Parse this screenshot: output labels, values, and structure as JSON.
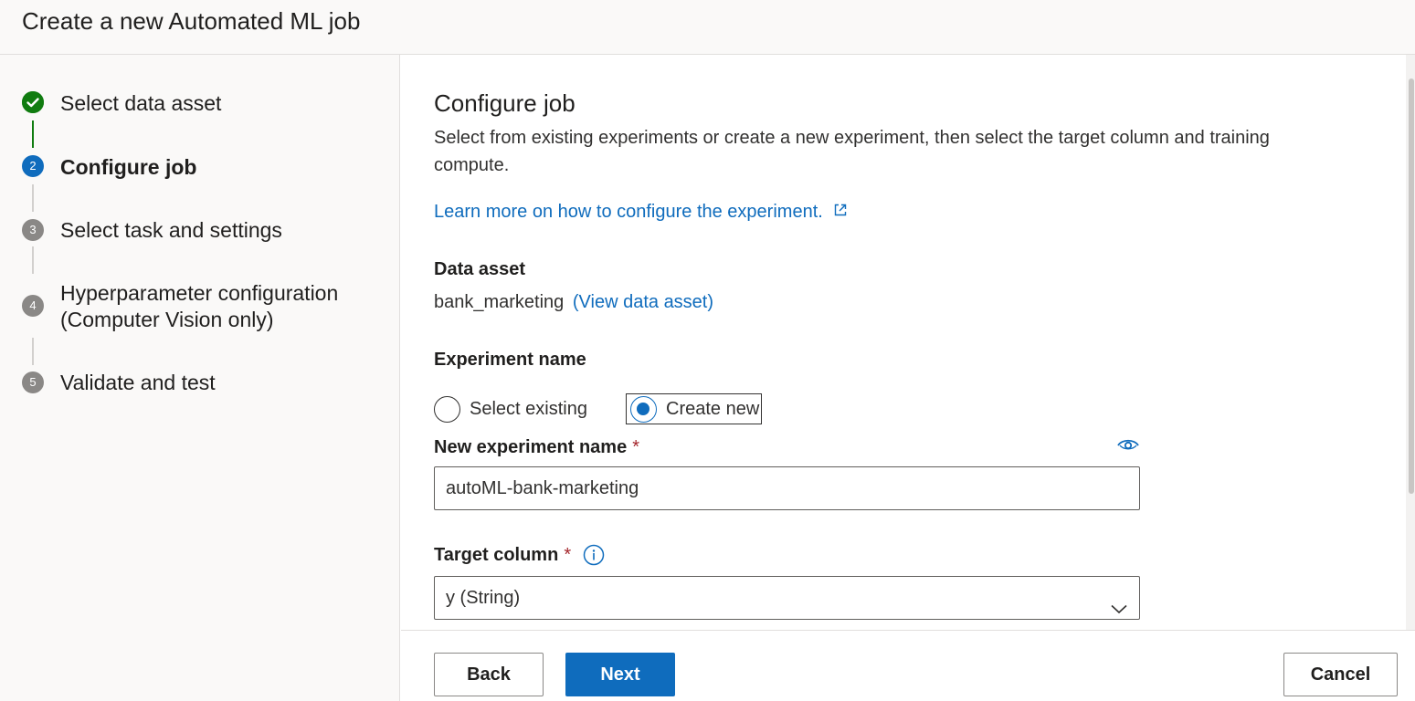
{
  "header": {
    "title": "Create a new Automated ML job"
  },
  "steps": [
    {
      "number": "",
      "label": "Select data asset",
      "status": "done"
    },
    {
      "number": "2",
      "label": "Configure job",
      "status": "active"
    },
    {
      "number": "3",
      "label": "Select task and settings",
      "status": "todo"
    },
    {
      "number": "4",
      "label_line1": "Hyperparameter configuration",
      "label_line2": "(Computer Vision only)",
      "status": "todo"
    },
    {
      "number": "5",
      "label": "Validate and test",
      "status": "todo"
    }
  ],
  "content": {
    "title": "Configure job",
    "description": "Select from existing experiments or create a new experiment, then select the target column and training compute.",
    "learn_more": "Learn more on how to configure the experiment.",
    "data_asset": {
      "label": "Data asset",
      "value": "bank_marketing",
      "link": "(View data asset)"
    },
    "experiment": {
      "label": "Experiment name",
      "option_existing": "Select existing",
      "option_new": "Create new",
      "selected": "Create new"
    },
    "new_experiment_name": {
      "label": "New experiment name",
      "required_mark": "*",
      "value": "autoML-bank-marketing"
    },
    "target_column": {
      "label": "Target column",
      "required_mark": "*",
      "value": "y (String)"
    }
  },
  "footer": {
    "back": "Back",
    "next": "Next",
    "cancel": "Cancel"
  },
  "colors": {
    "accent": "#0f6cbd",
    "done": "#107c10",
    "todo": "#8a8886",
    "required": "#a4262c"
  },
  "icons": {
    "step1": "checkmark-icon",
    "learn_more": "external-link-icon",
    "reveal": "eye-icon",
    "info": "info-icon",
    "dropdown": "chevron-down-icon"
  }
}
